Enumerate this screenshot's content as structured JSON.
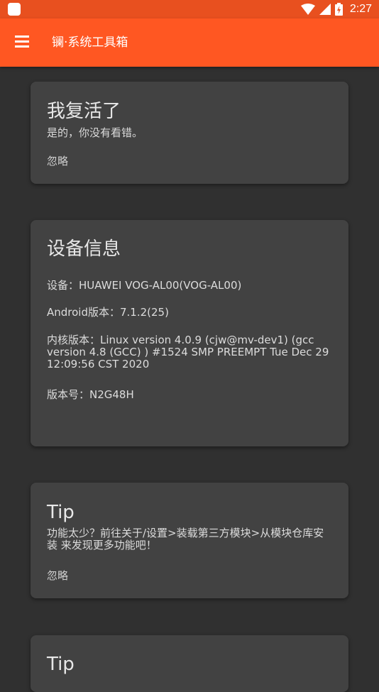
{
  "statusbar": {
    "time": "2:27",
    "icons": [
      "notification-icon",
      "wifi-icon",
      "signal-icon",
      "battery-charging-icon"
    ]
  },
  "appbar": {
    "title": "镧·系统工具箱",
    "menu_icon": "hamburger-menu-icon"
  },
  "cards": {
    "revived": {
      "title": "我复活了",
      "text": "是的，你没有看错。",
      "action": "忽略"
    },
    "device": {
      "title": "设备信息",
      "device": "设备：HUAWEI VOG-AL00(VOG-AL00)",
      "android": "Android版本：7.1.2(25)",
      "kernel": "内核版本：Linux version 4.0.9 (cjw@mv-dev1) (gcc version 4.8 (GCC) ) #1524 SMP PREEMPT Tue Dec 29 12:09:56 CST 2020",
      "build": "版本号：N2G48H"
    },
    "tip": {
      "title": "Tip",
      "text": "功能太少？前往关于/设置>装载第三方模块>从模块仓库安装 来发现更多功能吧！",
      "action": "忽略"
    },
    "tip2": {
      "title": "Tip"
    }
  },
  "colors": {
    "statusbar": "#e8501f",
    "appbar": "#ff5722",
    "background": "#303030",
    "card": "#424242"
  }
}
